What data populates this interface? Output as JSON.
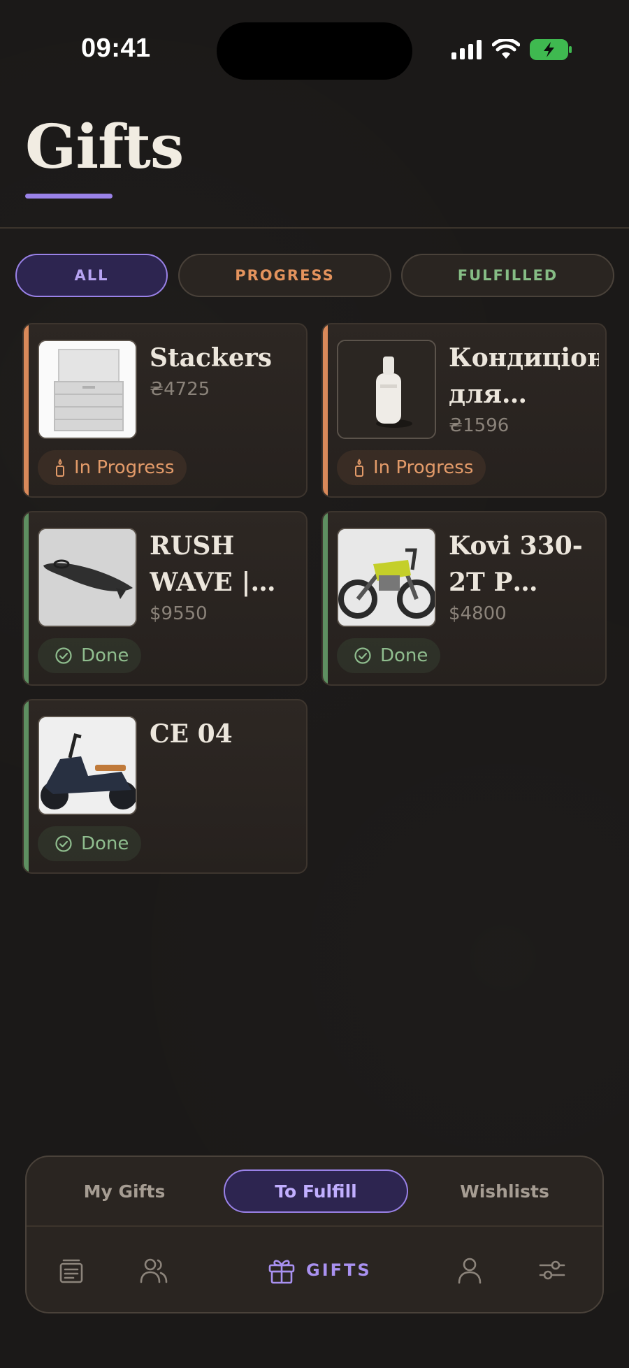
{
  "status_bar": {
    "time": "09:41"
  },
  "header": {
    "title": "Gifts"
  },
  "filters": [
    {
      "label": "ALL",
      "active": true
    },
    {
      "label": "PROGRESS",
      "active": false
    },
    {
      "label": "FULFILLED",
      "active": false
    }
  ],
  "gifts": [
    {
      "title": "Stackers",
      "price": "₴4725",
      "status": "In Progress"
    },
    {
      "title": "Кондиціонер для…",
      "price": "₴1596",
      "status": "In Progress"
    },
    {
      "title": "RUSH WAVE | E…",
      "price": "$9550",
      "status": "Done"
    },
    {
      "title": "Kovi 330-2T P…",
      "price": "$4800",
      "status": "Done"
    },
    {
      "title": "CE 04",
      "price": "",
      "status": "Done"
    }
  ],
  "bottom_nav": {
    "segments": [
      "My Gifts",
      "To Fulfill",
      "Wishlists"
    ],
    "active_segment": "To Fulfill",
    "icons": [
      "feed-icon",
      "friends-icon",
      "gift-icon",
      "profile-icon",
      "settings-sliders-icon"
    ],
    "gifts_label": "GIFTS"
  },
  "colors": {
    "background": "#1b1918",
    "accent_purple": "#9a82e8",
    "progress_orange": "#e29a69",
    "done_green": "#8fbd8e"
  }
}
